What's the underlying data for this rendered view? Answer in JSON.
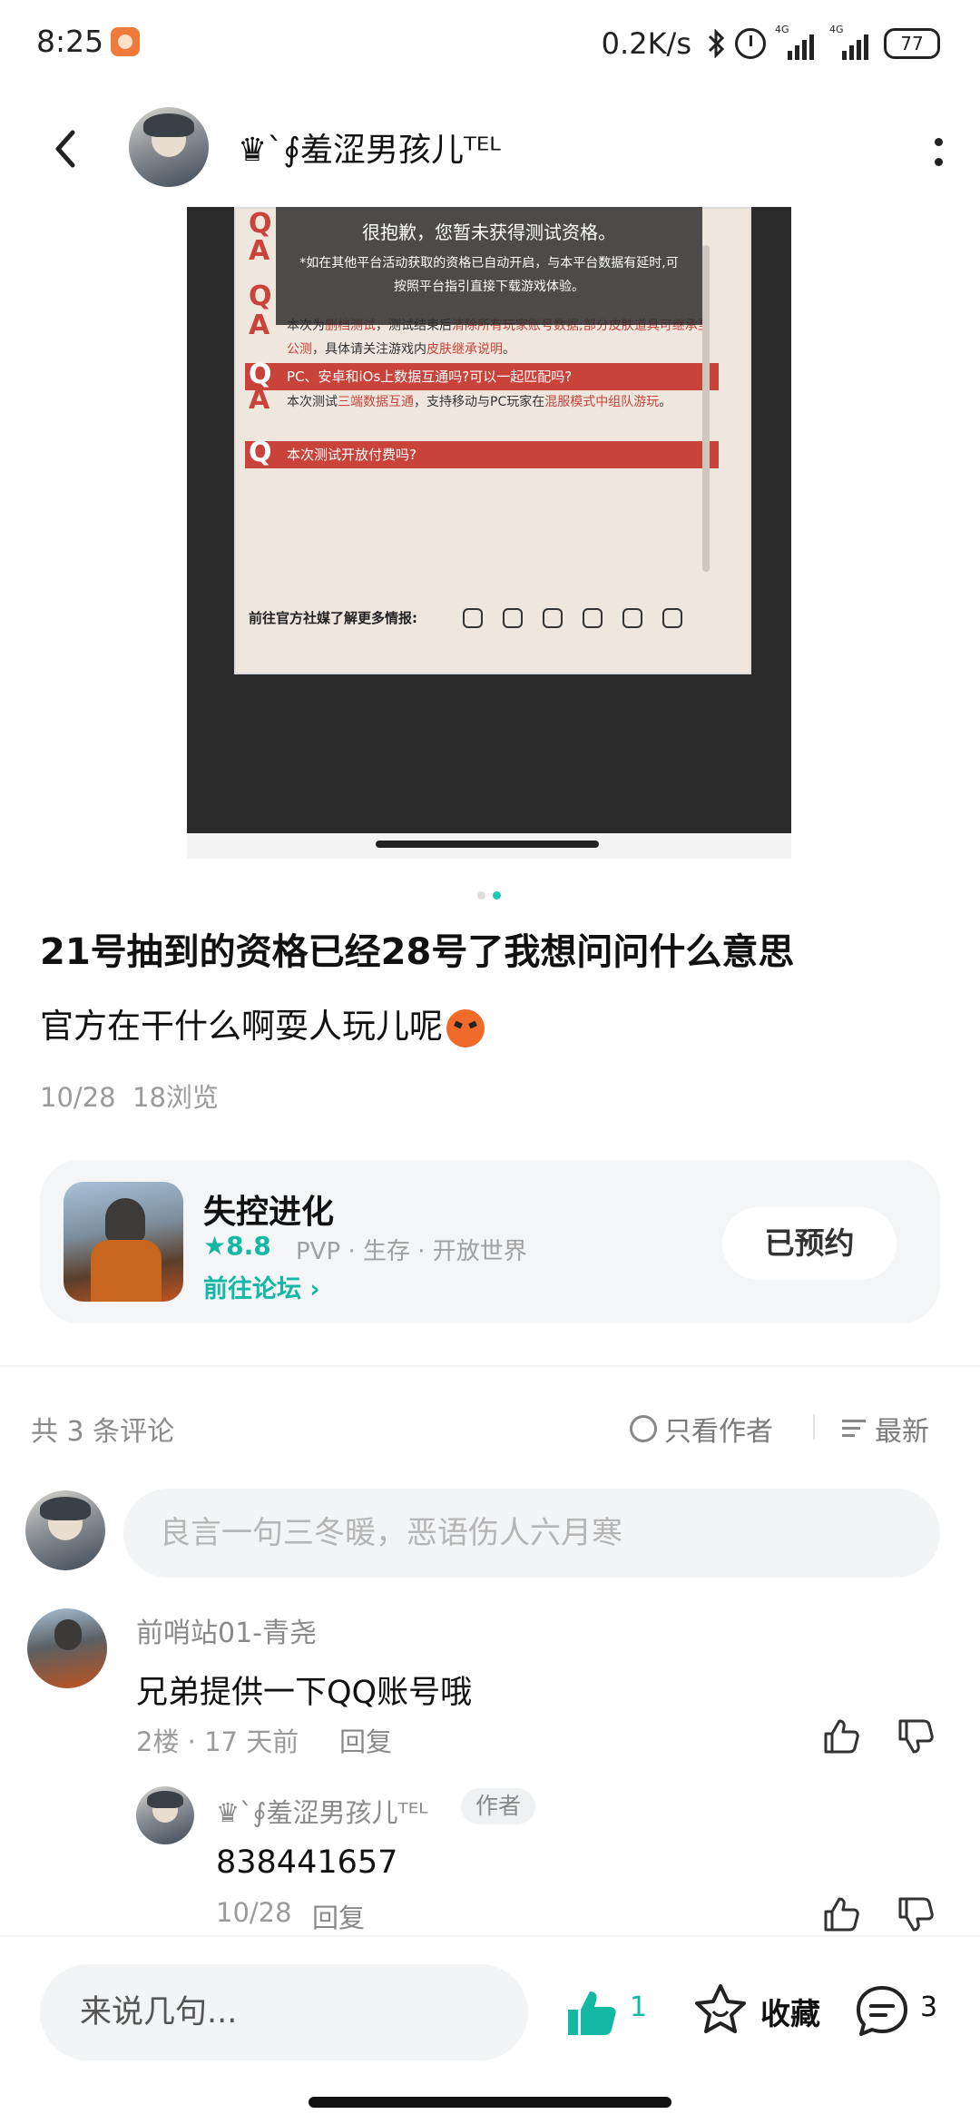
{
  "status_bar": {
    "time": "8:25",
    "network_speed": "0.2K/s",
    "signal_tag_1": "4G",
    "signal_tag_2": "4G",
    "battery": "77"
  },
  "header": {
    "author_name": "♛`∮羞涩男孩儿ᵀᴱᴸ",
    "icons": [
      "back-arrow-icon",
      "more-vertical-icon"
    ]
  },
  "post_image": {
    "toast_title": "很抱歉，您暂未获得测试资格。",
    "toast_text": "*如在其他平台活动获取的资格已自动开启，与本平台数据有延时,可按照平台指引直接下载游戏体验。",
    "faq": [
      {
        "q": "Q",
        "a": "A"
      },
      {
        "q": "Q",
        "a": "A",
        "answer_prefix": "本次为",
        "answer_red_1": "删档测试",
        "answer_mid": "，测试结束后",
        "answer_red_2": "清除所有玩家账号数据;部分皮肤道具可继承至公测",
        "answer_suffix": "，具体请关注游戏内",
        "answer_red_3": "皮肤继承说明",
        "answer_end": "。"
      },
      {
        "q": "Q",
        "question": "PC、安卓和iOs上数据互通吗?可以一起匹配吗?",
        "a": "A",
        "answer_prefix": "本次测试",
        "answer_red_1": "三端数据互通",
        "answer_mid": "，支持移动与PC玩家在",
        "answer_red_2": "混服模式中组队游玩",
        "answer_end": "。"
      },
      {
        "q": "Q",
        "question": "本次测试开放付费吗?"
      }
    ],
    "social_label": "前往官方社媒了解更多情报:",
    "page_count": 2,
    "active_page": 2
  },
  "post": {
    "title": "21号抽到的资格已经28号了我想问问什么意思",
    "body": "官方在干什么啊耍人玩儿呢",
    "body_emoji": "angry-face-icon",
    "date": "10/28",
    "views": "18浏览"
  },
  "game_card": {
    "name": "失控进化",
    "rating": "8.8",
    "tags": "PVP · 生存 · 开放世界",
    "forum_link": "前往论坛",
    "reserve_button": "已预约",
    "accent_color": "#12b8a4"
  },
  "comments_header": {
    "count_text": "共 3 条评论",
    "author_only": "只看作者",
    "sort": "最新"
  },
  "comment_input": {
    "placeholder": "良言一句三冬暖，恶语伤人六月寒"
  },
  "comments": [
    {
      "user": "前哨站01-青尧",
      "text": "兄弟提供一下QQ账号哦",
      "floor": "2楼",
      "time": "17 天前",
      "reply": "回复",
      "replies": [
        {
          "user": "♛`∮羞涩男孩儿ᵀᴱᴸ",
          "badge": "作者",
          "text": "838441657",
          "time": "10/28",
          "reply": "回复"
        }
      ]
    }
  ],
  "bottom_bar": {
    "input_placeholder": "来说几句...",
    "like_count": "1",
    "favorite_label": "收藏",
    "comment_count": "3"
  }
}
